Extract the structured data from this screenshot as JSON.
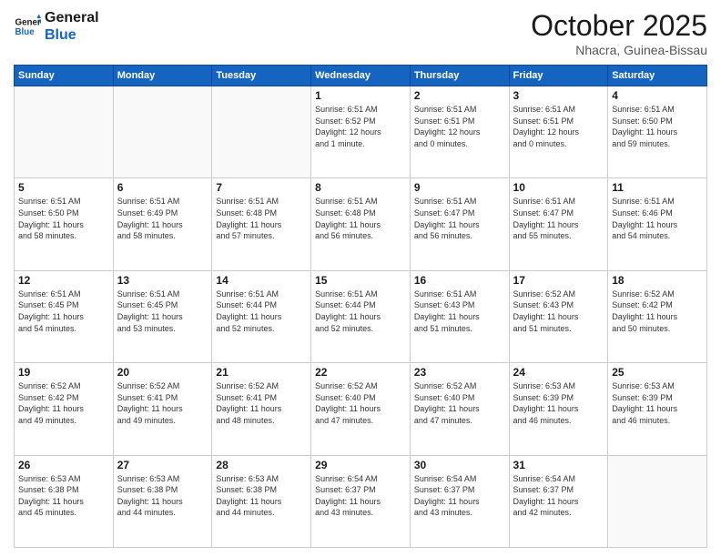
{
  "header": {
    "logo_general": "General",
    "logo_blue": "Blue",
    "month_title": "October 2025",
    "location": "Nhacra, Guinea-Bissau"
  },
  "days_of_week": [
    "Sunday",
    "Monday",
    "Tuesday",
    "Wednesday",
    "Thursday",
    "Friday",
    "Saturday"
  ],
  "weeks": [
    [
      {
        "day": "",
        "info": ""
      },
      {
        "day": "",
        "info": ""
      },
      {
        "day": "",
        "info": ""
      },
      {
        "day": "1",
        "info": "Sunrise: 6:51 AM\nSunset: 6:52 PM\nDaylight: 12 hours\nand 1 minute."
      },
      {
        "day": "2",
        "info": "Sunrise: 6:51 AM\nSunset: 6:51 PM\nDaylight: 12 hours\nand 0 minutes."
      },
      {
        "day": "3",
        "info": "Sunrise: 6:51 AM\nSunset: 6:51 PM\nDaylight: 12 hours\nand 0 minutes."
      },
      {
        "day": "4",
        "info": "Sunrise: 6:51 AM\nSunset: 6:50 PM\nDaylight: 11 hours\nand 59 minutes."
      }
    ],
    [
      {
        "day": "5",
        "info": "Sunrise: 6:51 AM\nSunset: 6:50 PM\nDaylight: 11 hours\nand 58 minutes."
      },
      {
        "day": "6",
        "info": "Sunrise: 6:51 AM\nSunset: 6:49 PM\nDaylight: 11 hours\nand 58 minutes."
      },
      {
        "day": "7",
        "info": "Sunrise: 6:51 AM\nSunset: 6:48 PM\nDaylight: 11 hours\nand 57 minutes."
      },
      {
        "day": "8",
        "info": "Sunrise: 6:51 AM\nSunset: 6:48 PM\nDaylight: 11 hours\nand 56 minutes."
      },
      {
        "day": "9",
        "info": "Sunrise: 6:51 AM\nSunset: 6:47 PM\nDaylight: 11 hours\nand 56 minutes."
      },
      {
        "day": "10",
        "info": "Sunrise: 6:51 AM\nSunset: 6:47 PM\nDaylight: 11 hours\nand 55 minutes."
      },
      {
        "day": "11",
        "info": "Sunrise: 6:51 AM\nSunset: 6:46 PM\nDaylight: 11 hours\nand 54 minutes."
      }
    ],
    [
      {
        "day": "12",
        "info": "Sunrise: 6:51 AM\nSunset: 6:45 PM\nDaylight: 11 hours\nand 54 minutes."
      },
      {
        "day": "13",
        "info": "Sunrise: 6:51 AM\nSunset: 6:45 PM\nDaylight: 11 hours\nand 53 minutes."
      },
      {
        "day": "14",
        "info": "Sunrise: 6:51 AM\nSunset: 6:44 PM\nDaylight: 11 hours\nand 52 minutes."
      },
      {
        "day": "15",
        "info": "Sunrise: 6:51 AM\nSunset: 6:44 PM\nDaylight: 11 hours\nand 52 minutes."
      },
      {
        "day": "16",
        "info": "Sunrise: 6:51 AM\nSunset: 6:43 PM\nDaylight: 11 hours\nand 51 minutes."
      },
      {
        "day": "17",
        "info": "Sunrise: 6:52 AM\nSunset: 6:43 PM\nDaylight: 11 hours\nand 51 minutes."
      },
      {
        "day": "18",
        "info": "Sunrise: 6:52 AM\nSunset: 6:42 PM\nDaylight: 11 hours\nand 50 minutes."
      }
    ],
    [
      {
        "day": "19",
        "info": "Sunrise: 6:52 AM\nSunset: 6:42 PM\nDaylight: 11 hours\nand 49 minutes."
      },
      {
        "day": "20",
        "info": "Sunrise: 6:52 AM\nSunset: 6:41 PM\nDaylight: 11 hours\nand 49 minutes."
      },
      {
        "day": "21",
        "info": "Sunrise: 6:52 AM\nSunset: 6:41 PM\nDaylight: 11 hours\nand 48 minutes."
      },
      {
        "day": "22",
        "info": "Sunrise: 6:52 AM\nSunset: 6:40 PM\nDaylight: 11 hours\nand 47 minutes."
      },
      {
        "day": "23",
        "info": "Sunrise: 6:52 AM\nSunset: 6:40 PM\nDaylight: 11 hours\nand 47 minutes."
      },
      {
        "day": "24",
        "info": "Sunrise: 6:53 AM\nSunset: 6:39 PM\nDaylight: 11 hours\nand 46 minutes."
      },
      {
        "day": "25",
        "info": "Sunrise: 6:53 AM\nSunset: 6:39 PM\nDaylight: 11 hours\nand 46 minutes."
      }
    ],
    [
      {
        "day": "26",
        "info": "Sunrise: 6:53 AM\nSunset: 6:38 PM\nDaylight: 11 hours\nand 45 minutes."
      },
      {
        "day": "27",
        "info": "Sunrise: 6:53 AM\nSunset: 6:38 PM\nDaylight: 11 hours\nand 44 minutes."
      },
      {
        "day": "28",
        "info": "Sunrise: 6:53 AM\nSunset: 6:38 PM\nDaylight: 11 hours\nand 44 minutes."
      },
      {
        "day": "29",
        "info": "Sunrise: 6:54 AM\nSunset: 6:37 PM\nDaylight: 11 hours\nand 43 minutes."
      },
      {
        "day": "30",
        "info": "Sunrise: 6:54 AM\nSunset: 6:37 PM\nDaylight: 11 hours\nand 43 minutes."
      },
      {
        "day": "31",
        "info": "Sunrise: 6:54 AM\nSunset: 6:37 PM\nDaylight: 11 hours\nand 42 minutes."
      },
      {
        "day": "",
        "info": ""
      }
    ]
  ]
}
